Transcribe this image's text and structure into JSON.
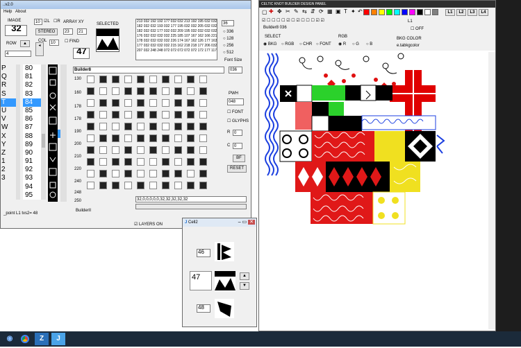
{
  "left_window": {
    "title": "..v2.0",
    "menu": [
      "Help",
      "About"
    ],
    "image_label": "IMAGE",
    "image_value": "32",
    "field_10": "10",
    "check_l": "L",
    "check_r": "R",
    "array_xy_label": "ARRAY XY",
    "stereo_btn": "STEREO",
    "array_x": "23",
    "array_y": "21",
    "row_label": "ROW",
    "col_label": "COL",
    "col_value": "10",
    "row_value": "4",
    "find_label": "FIND",
    "big_number": "47",
    "selected_label": "SELECTED",
    "number_grid": "213 032 192 192 177 032 032 213 192 195 032 032 195 032 032 32\n182 032 032 193 032 177 195 032 032 205 032 032 205 032 032 180\n182 032 032 177 032 032 209 195 032 032 032 032 032 032 032 032\n176 032 032 032 032 225 185 107 167 162 166 221 181 032 032 032\n178 032 032 032 032 226 174 167 162 126 177 163 181 032 032 032\n177 032 032 032 032 215 162 218 218 177 206 032 032 032 032 032\n207 032 248 248 072 072 072 072 072 172 177 117 086 032 032 032",
    "right_vals": [
      "36",
      "336",
      "128",
      "256",
      "512"
    ],
    "font_size_label": "Font Size",
    "builder_select": "Builder8",
    "font_select": "036",
    "pwh_label": "PWH",
    "pwh_value": "048",
    "font_check": "FONT",
    "glyphs_check": "GLYPHS",
    "r_label": "R",
    "c_label": "C",
    "r_value": "0",
    "c_value": "0",
    "bf_btn": "BF",
    "reset_btn": "RESET",
    "row_markers": [
      "130",
      "160",
      "178",
      "178",
      "190",
      "200",
      "210",
      "220",
      "240",
      "248",
      "250"
    ],
    "letters": [
      "P",
      "Q",
      "R",
      "S",
      "T",
      "U",
      "V",
      "W",
      "X",
      "Y",
      "Z",
      "1",
      "2",
      "3"
    ],
    "numbers": [
      "80",
      "81",
      "82",
      "83",
      "84",
      "85",
      "86",
      "87",
      "88",
      "89",
      "90",
      "91",
      "92",
      "93",
      "94",
      "95"
    ],
    "selected_index": 4,
    "seq_field": "32,0,0,0,0,0,32,32,32,32,32",
    "builder_label": "BuilderII",
    "status": "_point L1 tvs2= 48",
    "layers_on": "LAYERS ON"
  },
  "cell_window": {
    "title": "Cell2",
    "rows": [
      {
        "value": "46"
      },
      {
        "value": "47"
      },
      {
        "value": "48"
      }
    ]
  },
  "right_window": {
    "title": "CELTIC KNOT BUILDER DESIGN PANEL",
    "tool_buttons": [
      "L1",
      "L2",
      "L3",
      "L4"
    ],
    "builder_label": "Builder8 036",
    "l1_label": "L1",
    "off_label": "OFF",
    "select_label": "SELECT",
    "rgb_label": "RGB",
    "bkg_color_label": "BKG COLOR",
    "select_options": [
      "BKG",
      "RGB",
      "CHR",
      "FONT"
    ],
    "rgb_options": [
      "R",
      "G",
      "B"
    ],
    "bkg_value": "e.tabkgcolor",
    "palette": [
      "#ff0000",
      "#ff8000",
      "#ffff00",
      "#00ff00",
      "#00ffff",
      "#0000ff",
      "#ff00ff",
      "#000000",
      "#ffffff",
      "#808080"
    ]
  },
  "taskbar": {
    "items": [
      "start",
      "chrome",
      "zoom-app",
      "java-app"
    ]
  }
}
